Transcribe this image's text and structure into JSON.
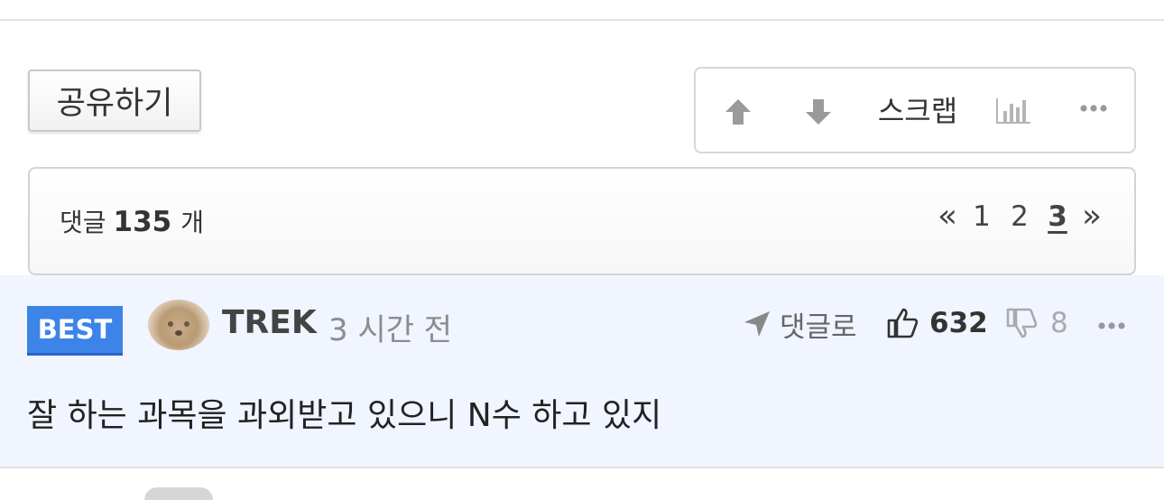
{
  "share": {
    "label": "공유하기"
  },
  "actions": {
    "upvote_icon": "arrow-up-icon",
    "downvote_icon": "arrow-down-icon",
    "scrap_label": "스크랩",
    "stats_icon": "bar-chart-icon",
    "more_icon": "ellipsis-icon"
  },
  "comments_header": {
    "prefix": "댓글",
    "count": "135",
    "suffix": "개"
  },
  "pagination": {
    "prev": "«",
    "pages": [
      "1",
      "2",
      "3"
    ],
    "current": "3",
    "next": "»"
  },
  "best_comment": {
    "badge": "BEST",
    "username": "TREK",
    "time": "3 시간 전",
    "reply_label": "댓글로",
    "likes": "632",
    "dislikes": "8",
    "text": "잘 하는 과목을 과외받고 있으니 N수 하고 있지"
  },
  "colors": {
    "accent": "#3d84e8",
    "best_background": "#f0f5ff",
    "border": "#d3d3d3"
  }
}
